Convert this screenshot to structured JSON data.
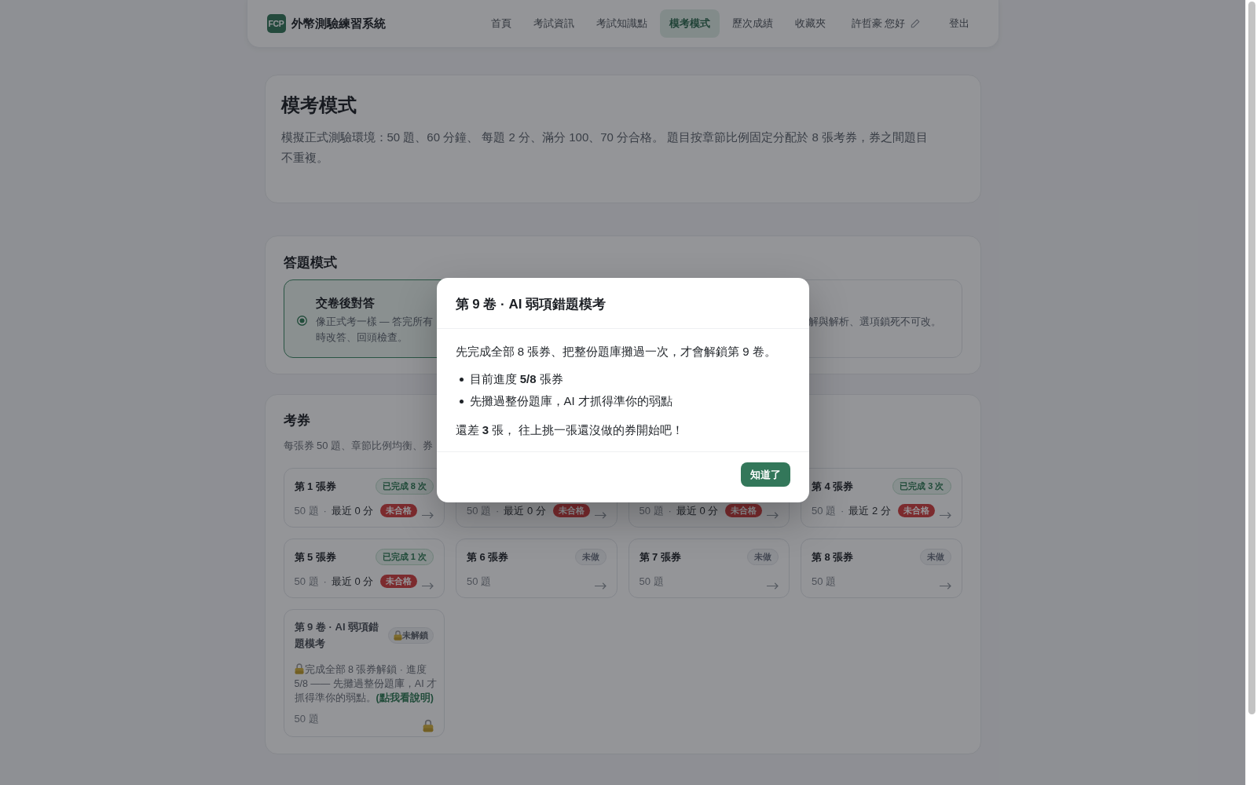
{
  "header": {
    "logo": "FCP",
    "title": "外幣測驗練習系統",
    "nav": [
      {
        "label": "首頁",
        "selected": false
      },
      {
        "label": "考試資訊",
        "selected": false
      },
      {
        "label": "考試知識點",
        "selected": false
      },
      {
        "label": "模考模式",
        "selected": true
      },
      {
        "label": "歷次成績",
        "selected": false
      },
      {
        "label": "收藏夾",
        "selected": false
      }
    ],
    "greeting": "許哲豪 您好",
    "logout": "登出"
  },
  "intro": {
    "title": "模考模式",
    "description": "模擬正式測驗環境：50 題、60 分鐘、 每題 2 分、滿分 100、70 分合格。 題目按章節比例固定分配於 8 張考券，券之間題目不重複。"
  },
  "answer_mode": {
    "title": "答題模式",
    "options": [
      {
        "title": "交卷後對答",
        "description_lines": [
          "像正式考一樣 — 答完所有",
          "時改答、回頭檢查。"
        ],
        "selected": true
      },
      {
        "description_lines": [
          "解與解析、選項鎖死不可改。"
        ],
        "selected": false
      }
    ]
  },
  "papers": {
    "title": "考券",
    "subtitle": "每張券 50 題、章節比例均衡、券",
    "cards": [
      {
        "kind": "paper",
        "title": "第 1 張券",
        "status": {
          "kind": "done",
          "label": "已完成 8 次"
        },
        "questions": "50 題",
        "separator": "·",
        "recent": "最近 0 分",
        "result": {
          "kind": "fail",
          "label": "未合格"
        }
      },
      {
        "kind": "paper",
        "questions": "50 題",
        "separator": "·",
        "recent": "最近 0 分",
        "result": {
          "kind": "fail",
          "label": "未合格"
        }
      },
      {
        "kind": "paper",
        "questions": "50 題",
        "separator": "·",
        "recent": "最近 0 分",
        "result": {
          "kind": "fail",
          "label": "未合格"
        }
      },
      {
        "kind": "paper",
        "title": "第 4 張券",
        "status": {
          "kind": "done",
          "label": "已完成 3 次"
        },
        "questions": "50 題",
        "separator": "·",
        "recent": "最近 2 分",
        "result": {
          "kind": "fail",
          "label": "未合格"
        }
      },
      {
        "kind": "paper",
        "title": "第 5 張券",
        "status": {
          "kind": "done",
          "label": "已完成 1 次"
        },
        "questions": "50 題",
        "separator": "·",
        "recent": "最近 0 分",
        "result": {
          "kind": "fail",
          "label": "未合格"
        }
      },
      {
        "kind": "paper",
        "title": "第 6 張券",
        "status": {
          "kind": "todo",
          "label": "未做"
        },
        "questions": "50 題"
      },
      {
        "kind": "paper",
        "title": "第 7 張券",
        "status": {
          "kind": "todo",
          "label": "未做"
        },
        "questions": "50 題"
      },
      {
        "kind": "paper",
        "title": "第 8 張券",
        "status": {
          "kind": "todo",
          "label": "未做"
        },
        "questions": "50 題"
      },
      {
        "kind": "locked",
        "title": "第 9 卷 · AI 弱項錯題模考",
        "status": {
          "kind": "locked",
          "label": "未解鎖"
        },
        "note": "完成全部 8 張券解鎖 · 進度 5/8 —— 先攤過整份題庫，AI 才抓得準你的弱點。",
        "note_link": "(點我看說明)",
        "questions": "50 題"
      }
    ]
  },
  "modal": {
    "title": "第 9 卷 · AI 弱項錯題模考",
    "message": "先完成全部 8 張券、把整份題庫攤過一次，才會解鎖第 9 卷。",
    "points": [
      "目前進度 **5/8** 張券",
      "先攤過整份題庫，AI 才抓得準你的弱點"
    ],
    "note": "還差 **3** 張， 往上挑一張還沒做的券開始吧！",
    "button": "知道了"
  }
}
